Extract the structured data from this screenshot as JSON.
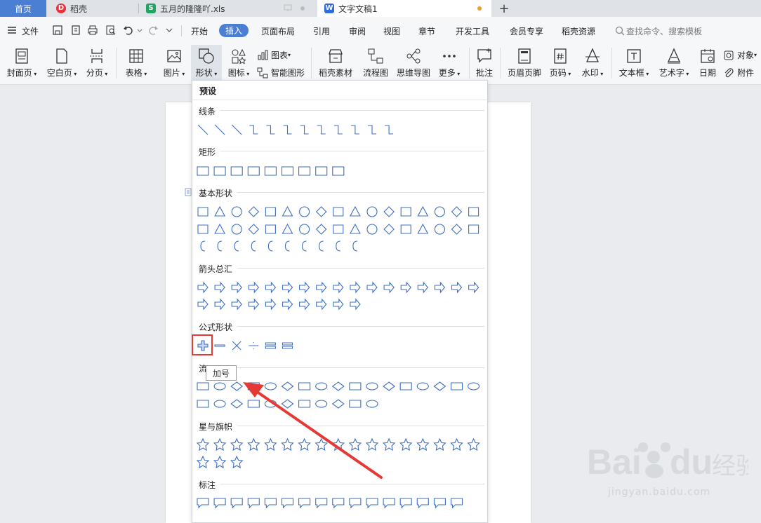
{
  "tabs": {
    "home": "首页",
    "daoke": "稻壳",
    "xls": "五月的隆隆吖.xls",
    "doc": "文字文稿1",
    "add": "+"
  },
  "menu": {
    "file": "文件",
    "items": [
      "开始",
      "插入",
      "页面布局",
      "引用",
      "审阅",
      "视图",
      "章节",
      "开发工具",
      "会员专享",
      "稻壳资源"
    ],
    "search_placeholder": "查找命令、搜索模板"
  },
  "ribbon": {
    "cover": "封面页",
    "blank": "空白页",
    "pagebreak": "分页",
    "table": "表格",
    "picture": "图片",
    "shape": "形状",
    "icon": "图标",
    "chart": "图表",
    "smartart": "智能图形",
    "daoke_material": "稻壳素材",
    "flowchart": "流程图",
    "mindmap": "思维导图",
    "more": "更多",
    "comment": "批注",
    "header_footer": "页眉页脚",
    "page_number": "页码",
    "watermark": "水印",
    "textbox": "文本框",
    "wordart": "艺术字",
    "date": "日期",
    "object": "对象",
    "attachment": "附件"
  },
  "shapes_panel": {
    "title": "预设",
    "sections": [
      "线条",
      "矩形",
      "基本形状",
      "箭头总汇",
      "公式形状",
      "流程图",
      "星与旗帜",
      "标注"
    ],
    "flow_partial": "流",
    "tooltip": "加号"
  },
  "watermark": {
    "brand": "Baidu经验",
    "url": "jingyan.baidu.com"
  },
  "colors": {
    "accent": "#4a7fd4",
    "shape_stroke": "#3d6fc2",
    "highlight": "#e53935"
  }
}
